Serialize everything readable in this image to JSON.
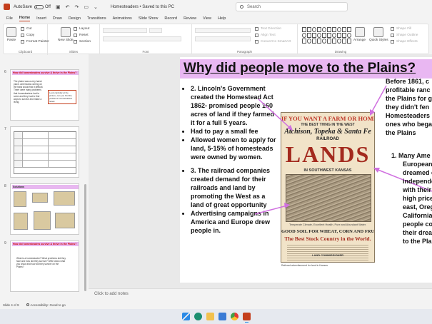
{
  "titlebar": {
    "autosave_label": "AutoSave",
    "autosave_state": "Off",
    "doc_title": "Homesteaders  •  Saved to this PC",
    "search_placeholder": "Search"
  },
  "tabs": [
    "File",
    "Home",
    "Insert",
    "Draw",
    "Design",
    "Transitions",
    "Animations",
    "Slide Show",
    "Record",
    "Review",
    "View",
    "Help"
  ],
  "active_tab": "Home",
  "ribbon": {
    "paste": "Paste",
    "cut": "Cut",
    "copy": "Copy",
    "format_painter": "Format Painter",
    "clipboard": "Clipboard",
    "new_slide": "New Slide",
    "layout": "Layout",
    "reset": "Reset",
    "section": "Section",
    "slides": "Slides",
    "font": "Font",
    "paragraph": "Paragraph",
    "text_direction": "Text Direction",
    "align_text": "Align Text",
    "convert_smartart": "Convert to SmartArt",
    "drawing": "Drawing",
    "arrange": "Arrange",
    "quick_styles": "Quick Styles",
    "shape_fill": "Shape Fill",
    "shape_outline": "Shape Outline",
    "shape_effects": "Shape Effects"
  },
  "thumbnails": [
    {
      "number": "6",
      "title": "How did homesteaders survive & thrive in the Plains?",
      "body": "The plains was a very harsh place. Americans coming on the trails would find it difficult. There were many problems that homesteaders had to solve and they had to find ways to survive and make a living.",
      "note": "Look carefully at the picture, can you find the problems homesteaders faced."
    },
    {
      "number": "7"
    },
    {
      "number": "8",
      "title": "Solutions"
    },
    {
      "number": "9",
      "title": "How did homesteaders survive & thrive in the Plains?",
      "body": "What is a homesteader? What problems did they face and how did they survive? Write down what you know and how did they survive on the Plains?"
    }
  ],
  "slide": {
    "title": "Why did people move to the Plains?",
    "left_bullets_1": [
      "2. Lincoln's Government created the Homestead Act 1862- promised people 160 acres of land if they farmed it for a full 5 years.",
      "Had to pay a small fee",
      "Allowed women to apply for land, 5-15% of homesteads were owned by women."
    ],
    "left_bullets_2": [
      "3. The railroad companies created demand for their railroads and land by promoting the West as a land of great opportunity",
      "Advertising campaigns in America and Europe drew people in."
    ],
    "right_para_lines": [
      "Before 1861, c",
      "profitable ranc",
      "the Plains for g",
      "they didn't fen",
      "Homesteaders",
      "ones who bega",
      "the Plains"
    ],
    "right_list_lines": [
      "1.   Many Ame",
      "European",
      "dreamed o",
      "independe",
      "with their",
      "high price",
      "east, Oreg",
      "California",
      "people co",
      "their drea",
      "to the Plai"
    ],
    "poster": {
      "line1": "IF YOU WANT A FARM OR HOME",
      "line2": "THE BEST THING IN THE WEST",
      "line3": "Atchison, Topeka & Santa Fe",
      "line4": "RAILROAD",
      "lands": "LANDS",
      "line5": "IN SOUTHWEST KANSAS",
      "line6": "Temperate Climate, Excellent Health, Pure and Abundant Water.",
      "line7": "GOOD SOIL FOR WHEAT, CORN AND FRUIT.",
      "line8": "The Best Stock Country in the World.",
      "line9": "LAND COMMISSIONER"
    },
    "caption": "Railroad advertisement for land in Kansas"
  },
  "notes_placeholder": "Click to add notes",
  "status": {
    "slide_counter": "Slide 4 of 9",
    "accessibility": "Accessibility: Good to go"
  },
  "colors": {
    "accent": "#c43e1c",
    "title_band": "#e9b7f2",
    "arrow": "#d070e0"
  }
}
